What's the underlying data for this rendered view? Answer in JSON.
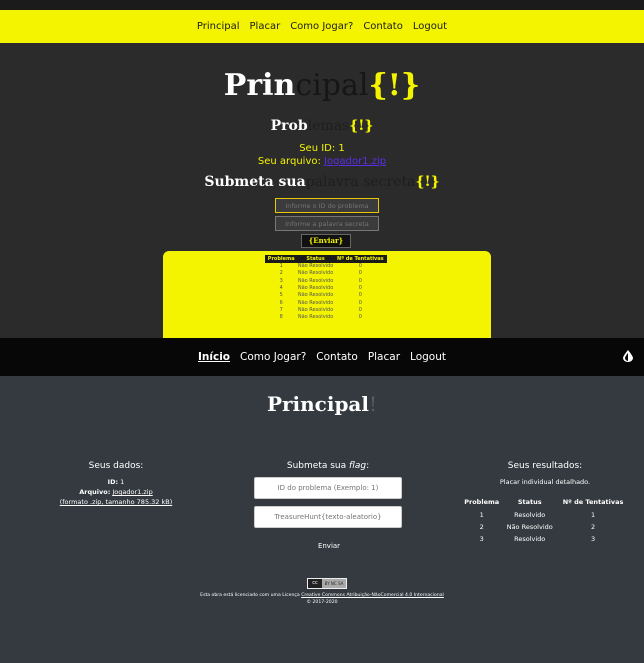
{
  "top": {
    "nav": [
      "Principal",
      "Placar",
      "Como Jogar?",
      "Contato",
      "Logout"
    ],
    "title": {
      "a": "Prin",
      "b": "cipal",
      "c": "{!}"
    },
    "sub": {
      "a": "Prob",
      "b": "lemas",
      "c": "{!}"
    },
    "id_line": "Seu ID: 1",
    "file_label": "Seu arquivo:",
    "file_link": "Jogador1.zip",
    "submit": {
      "a": "Submeta sua",
      "b": "palavra secreta",
      "c": "{!}"
    },
    "input1_placeholder": "Informe o ID do problema",
    "input2_placeholder": "Informe a palavra secreta",
    "button": "{Enviar}",
    "table_headers": [
      "Problema",
      "Status",
      "Nº de Tentativas"
    ],
    "rows": [
      [
        "1",
        "Não Resolvido",
        "0"
      ],
      [
        "2",
        "Não Resolvido",
        "0"
      ],
      [
        "3",
        "Não Resolvido",
        "0"
      ],
      [
        "4",
        "Não Resolvido",
        "0"
      ],
      [
        "5",
        "Não Resolvido",
        "0"
      ],
      [
        "6",
        "Não Resolvido",
        "0"
      ],
      [
        "7",
        "Não Resolvido",
        "0"
      ],
      [
        "8",
        "Não Resolvido",
        "0"
      ]
    ]
  },
  "nav": {
    "items": [
      "Início",
      "Como Jogar?",
      "Contato",
      "Placar",
      "Logout"
    ],
    "toggle_icon": "contrast-icon"
  },
  "bottom": {
    "title": "Principal",
    "title_suffix": "!",
    "data": {
      "title": "Seus dados:",
      "id_label": "ID:",
      "id_value": "1",
      "file_label": "Arquivo:",
      "file_link": "Jogador1.zip",
      "file_info": "(formato .zip, tamanho 785.32 kB)"
    },
    "submit": {
      "title_a": "Submeta sua",
      "title_b": "flag",
      "title_c": ":",
      "input1_placeholder": "ID do problema (Exemplo: 1)",
      "input2_placeholder": "TreasureHunt{texto-aleatorio}",
      "button": "Enviar"
    },
    "results": {
      "title": "Seus resultados:",
      "subtitle": "Placar individual detalhado.",
      "headers": [
        "Problema",
        "Status",
        "Nº de Tentativas"
      ],
      "rows": [
        [
          "1",
          "Resolvido",
          "1"
        ],
        [
          "2",
          "Não Resolvido",
          "2"
        ],
        [
          "3",
          "Resolvido",
          "3"
        ]
      ]
    },
    "license": {
      "badge_cc": "cc",
      "badge_rest": "BY NC SA",
      "text": "Esta obra está licenciado com uma Licença",
      "link": "Creative Commons Atribuição-NãoComercial 4.0 Internacional",
      "year": "© 2017-2020"
    }
  },
  "colors": {
    "yellow": "#f4f400",
    "dark": "#2b2b2b",
    "slate": "#343a40",
    "black": "#070707"
  }
}
